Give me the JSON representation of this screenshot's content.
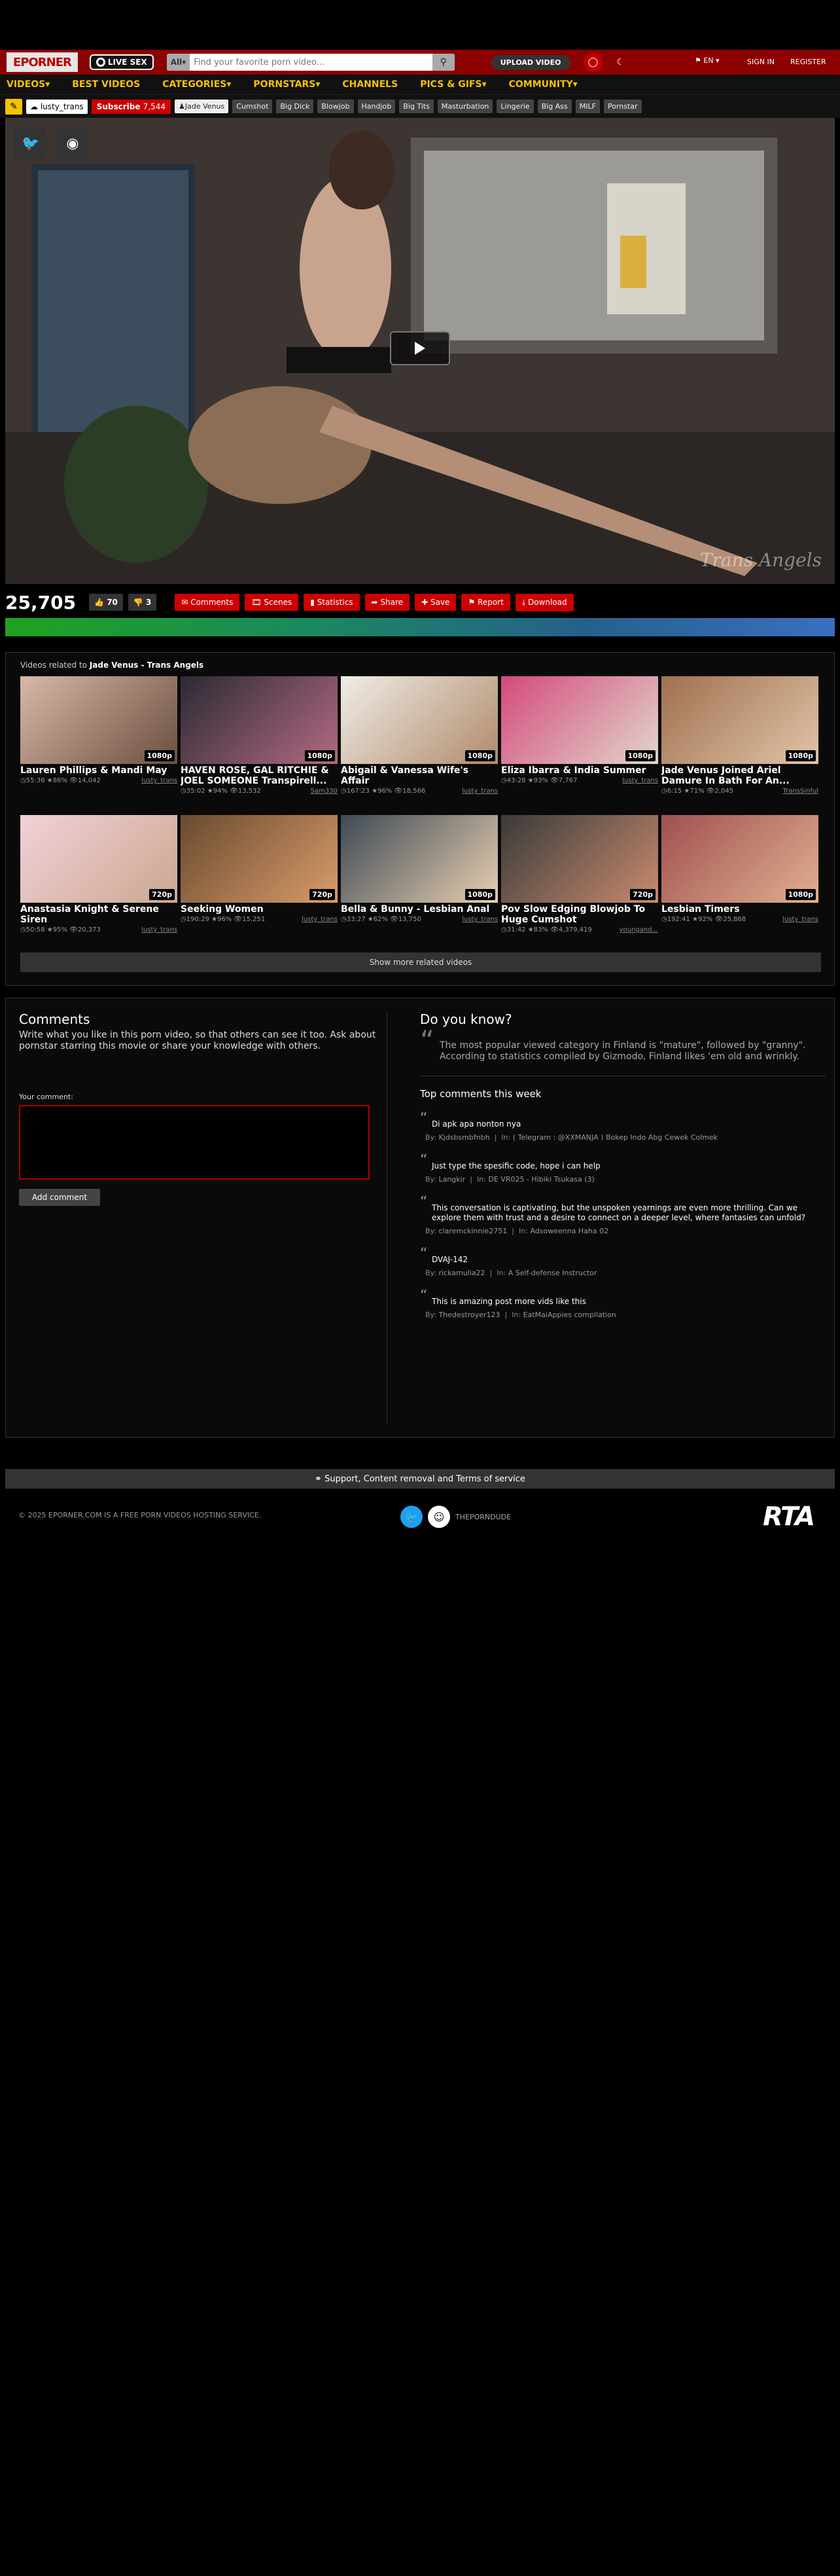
{
  "header": {
    "logo": "EPORNER",
    "livesex": "LIVE SEX",
    "search_select": "All",
    "search_placeholder": "Find your favorite porn video...",
    "upload": "UPLOAD VIDEO",
    "lang": "EN",
    "signin": "SIGN IN",
    "register": "REGISTER"
  },
  "nav": [
    "VIDEOS▾",
    "BEST VIDEOS",
    "CATEGORIES▾",
    "PORNSTARS▾",
    "CHANNELS",
    "PICS & GIFS▾",
    "COMMUNITY▾"
  ],
  "tagbar": {
    "uploader": "lusty_trans",
    "subscribe": "Subscribe",
    "subscribe_count": "7,544",
    "pornstar": "Jade Venus",
    "tags": [
      "Cumshot",
      "Big Dick",
      "Blowjob",
      "Handjob",
      "Big Tits",
      "Masturbation",
      "Lingerie",
      "Big Ass",
      "MILF",
      "Pornstar"
    ]
  },
  "player": {
    "watermark": "Trans Angels"
  },
  "actions": {
    "views": "25,705",
    "likes": "70",
    "dislikes": "3",
    "buttons": [
      "Comments",
      "Scenes",
      "Statistics",
      "Share",
      "Save",
      "Report",
      "Download"
    ]
  },
  "related": {
    "prefix": "Videos related to",
    "subject": "Jade Venus - Trans Angels",
    "show_more": "Show more related videos",
    "items": [
      {
        "title": "Lauren Phillips & Mandi May",
        "res": "1080p",
        "duration": "55:36",
        "rating": "86%",
        "views": "14,042",
        "uploader": "lusty_trans"
      },
      {
        "title": "HAVEN ROSE, GAL RITCHIE & JOEL SOMEONE Transpirell...",
        "res": "1080p",
        "duration": "35:02",
        "rating": "94%",
        "views": "13,532",
        "uploader": "Sam330"
      },
      {
        "title": "Abigail & Vanessa Wife's Affair",
        "res": "1080p",
        "duration": "167:23",
        "rating": "96%",
        "views": "18,566",
        "uploader": "lusty_trans"
      },
      {
        "title": "Eliza Ibarra & India Summer",
        "res": "1080p",
        "duration": "43:28",
        "rating": "93%",
        "views": "7,767",
        "uploader": "lusty_trans"
      },
      {
        "title": "Jade Venus Joined Ariel Damure In Bath For An...",
        "res": "1080p",
        "duration": "6:15",
        "rating": "71%",
        "views": "2,045",
        "uploader": "TransSinful"
      },
      {
        "title": "Anastasia Knight & Serene Siren",
        "res": "720p",
        "duration": "50:58",
        "rating": "95%",
        "views": "20,373",
        "uploader": "lusty_trans"
      },
      {
        "title": "Seeking Women",
        "res": "720p",
        "duration": "190:29",
        "rating": "96%",
        "views": "15,251",
        "uploader": "lusty_trans"
      },
      {
        "title": "Bella & Bunny - Lesbian Anal",
        "res": "1080p",
        "duration": "33:27",
        "rating": "62%",
        "views": "13,750",
        "uploader": "lusty_trans"
      },
      {
        "title": "Pov Slow Edging Blowjob To Huge Cumshot",
        "res": "720p",
        "duration": "31:42",
        "rating": "83%",
        "views": "4,379,419",
        "uploader": "youngand..."
      },
      {
        "title": "Lesbian Timers",
        "res": "1080p",
        "duration": "192:41",
        "rating": "92%",
        "views": "25,868",
        "uploader": "lusty_trans"
      }
    ]
  },
  "comments": {
    "title": "Comments",
    "desc": "Write what you like in this porn video, so that others can see it too. Ask about pornstar starring this movie or share your knowledge with others.",
    "your_label": "Your comment:",
    "add_button": "Add comment",
    "know_title": "Do you know?",
    "fact": "The most popular viewed category in Finland is \"mature\", followed by \"granny\". According to statistics compiled by Gizmodo, Finland likes 'em old and wrinkly.",
    "top_title": "Top comments this week",
    "top": [
      {
        "text": "Di apk apa nonton nya",
        "by": "Kjdsbsmbfnbh",
        "in": "( Telegram : @XXMANJA ) Bokep Indo Abg Cewek Colmek"
      },
      {
        "text": "Just type the spesific code, hope i can help",
        "by": "Langkir",
        "in": "DE VR025 - Hibiki Tsukasa (3)"
      },
      {
        "text": "This conversation is captivating, but the unspoken yearnings are even more thrilling. Can we explore them with trust and a desire to connect on a deeper level, where fantasies can unfold?",
        "by": "claremckinnie2751",
        "in": "Adsoweenna Haha 02"
      },
      {
        "text": "DVAJ-142",
        "by": "rickamulia22",
        "in": "A Self-defense Instructor"
      },
      {
        "text": "This is amazing post more vids like this",
        "by": "Thedestroyer123",
        "in": "EatMaiAppies compilation"
      }
    ]
  },
  "footer": {
    "support": "Support, Content removal and Terms of service",
    "copyright": "© 2025 EPORNER.COM IS A FREE PORN VIDEOS HOSTING SERVICE.",
    "social_label": "THEPORNDUDE",
    "rta": "RTA"
  },
  "colors": {
    "brand": "#8c0000",
    "accent": "#f5c200",
    "button": "#cc0000"
  }
}
